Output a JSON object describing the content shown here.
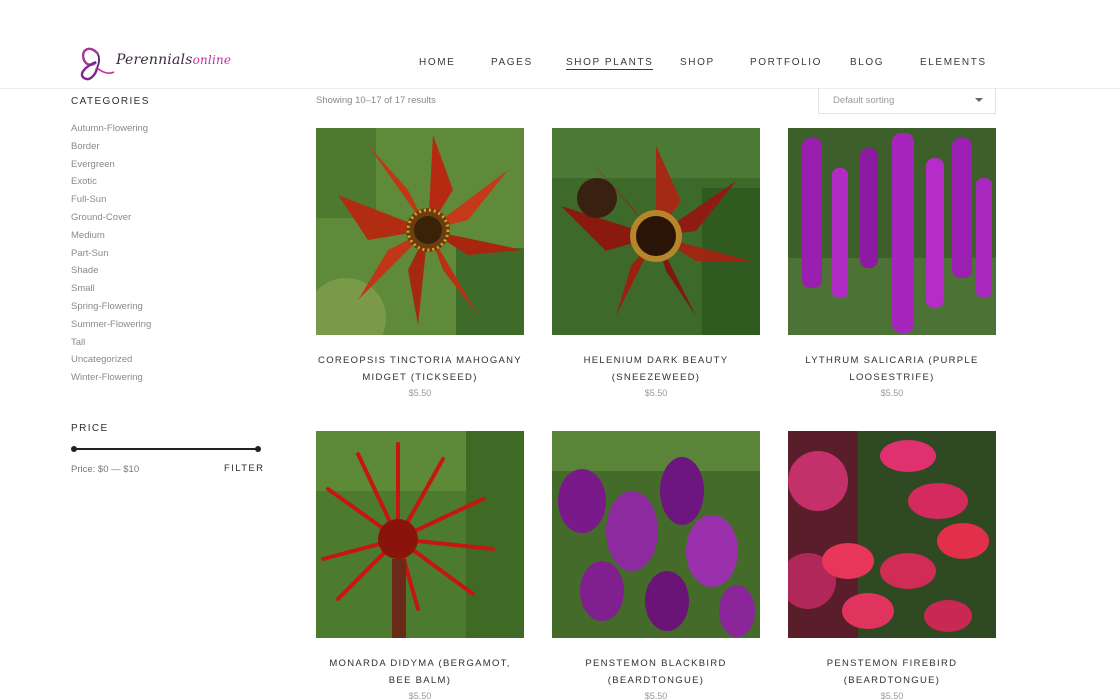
{
  "brand": {
    "name_main": "Perennials",
    "name_accent": "online"
  },
  "nav": {
    "items": [
      {
        "label": "HOME"
      },
      {
        "label": "PAGES"
      },
      {
        "label": "SHOP PLANTS",
        "active": true
      },
      {
        "label": "SHOP"
      },
      {
        "label": "PORTFOLIO"
      },
      {
        "label": "BLOG"
      },
      {
        "label": "ELEMENTS"
      }
    ]
  },
  "sidebar": {
    "categories_title": "CATEGORIES",
    "categories": [
      "Autumn-Flowering",
      "Border",
      "Evergreen",
      "Exotic",
      "Full-Sun",
      "Ground-Cover",
      "Medium",
      "Part-Sun",
      "Shade",
      "Small",
      "Spring-Flowering",
      "Summer-Flowering",
      "Tall",
      "Uncategorized",
      "Winter-Flowering"
    ],
    "price_title": "PRICE",
    "price_range_label": "Price: $0 — $10",
    "price_min": 0,
    "price_max": 10,
    "filter_label": "FILTER"
  },
  "results": {
    "count_text": "Showing 10–17 of 17 results",
    "sort_selected": "Default sorting"
  },
  "products": [
    {
      "title": "COREOPSIS TINCTORIA MAHOGANY MIDGET (TICKSEED)",
      "price": "$5.50",
      "image": "red-orange-daisy-flower"
    },
    {
      "title": "HELENIUM DARK BEAUTY (SNEEZEWEED)",
      "price": "$5.50",
      "image": "dark-red-helenium-flower"
    },
    {
      "title": "LYTHRUM SALICARIA (PURPLE LOOSESTRIFE)",
      "price": "$5.50",
      "image": "purple-spike-flowers"
    },
    {
      "title": "MONARDA DIDYMA (BERGAMOT, BEE BALM)",
      "price": "$5.50",
      "image": "red-bee-balm-flower"
    },
    {
      "title": "PENSTEMON BLACKBIRD (BEARDTONGUE)",
      "price": "$5.50",
      "image": "purple-penstemon-flowers"
    },
    {
      "title": "PENSTEMON FIREBIRD (BEARDTONGUE)",
      "price": "$5.50",
      "image": "pink-red-penstemon-flowers"
    }
  ],
  "colors": {
    "accent": "#c62fa8",
    "text_dark": "#2f2f2f",
    "text_muted": "#8a8a8a"
  }
}
